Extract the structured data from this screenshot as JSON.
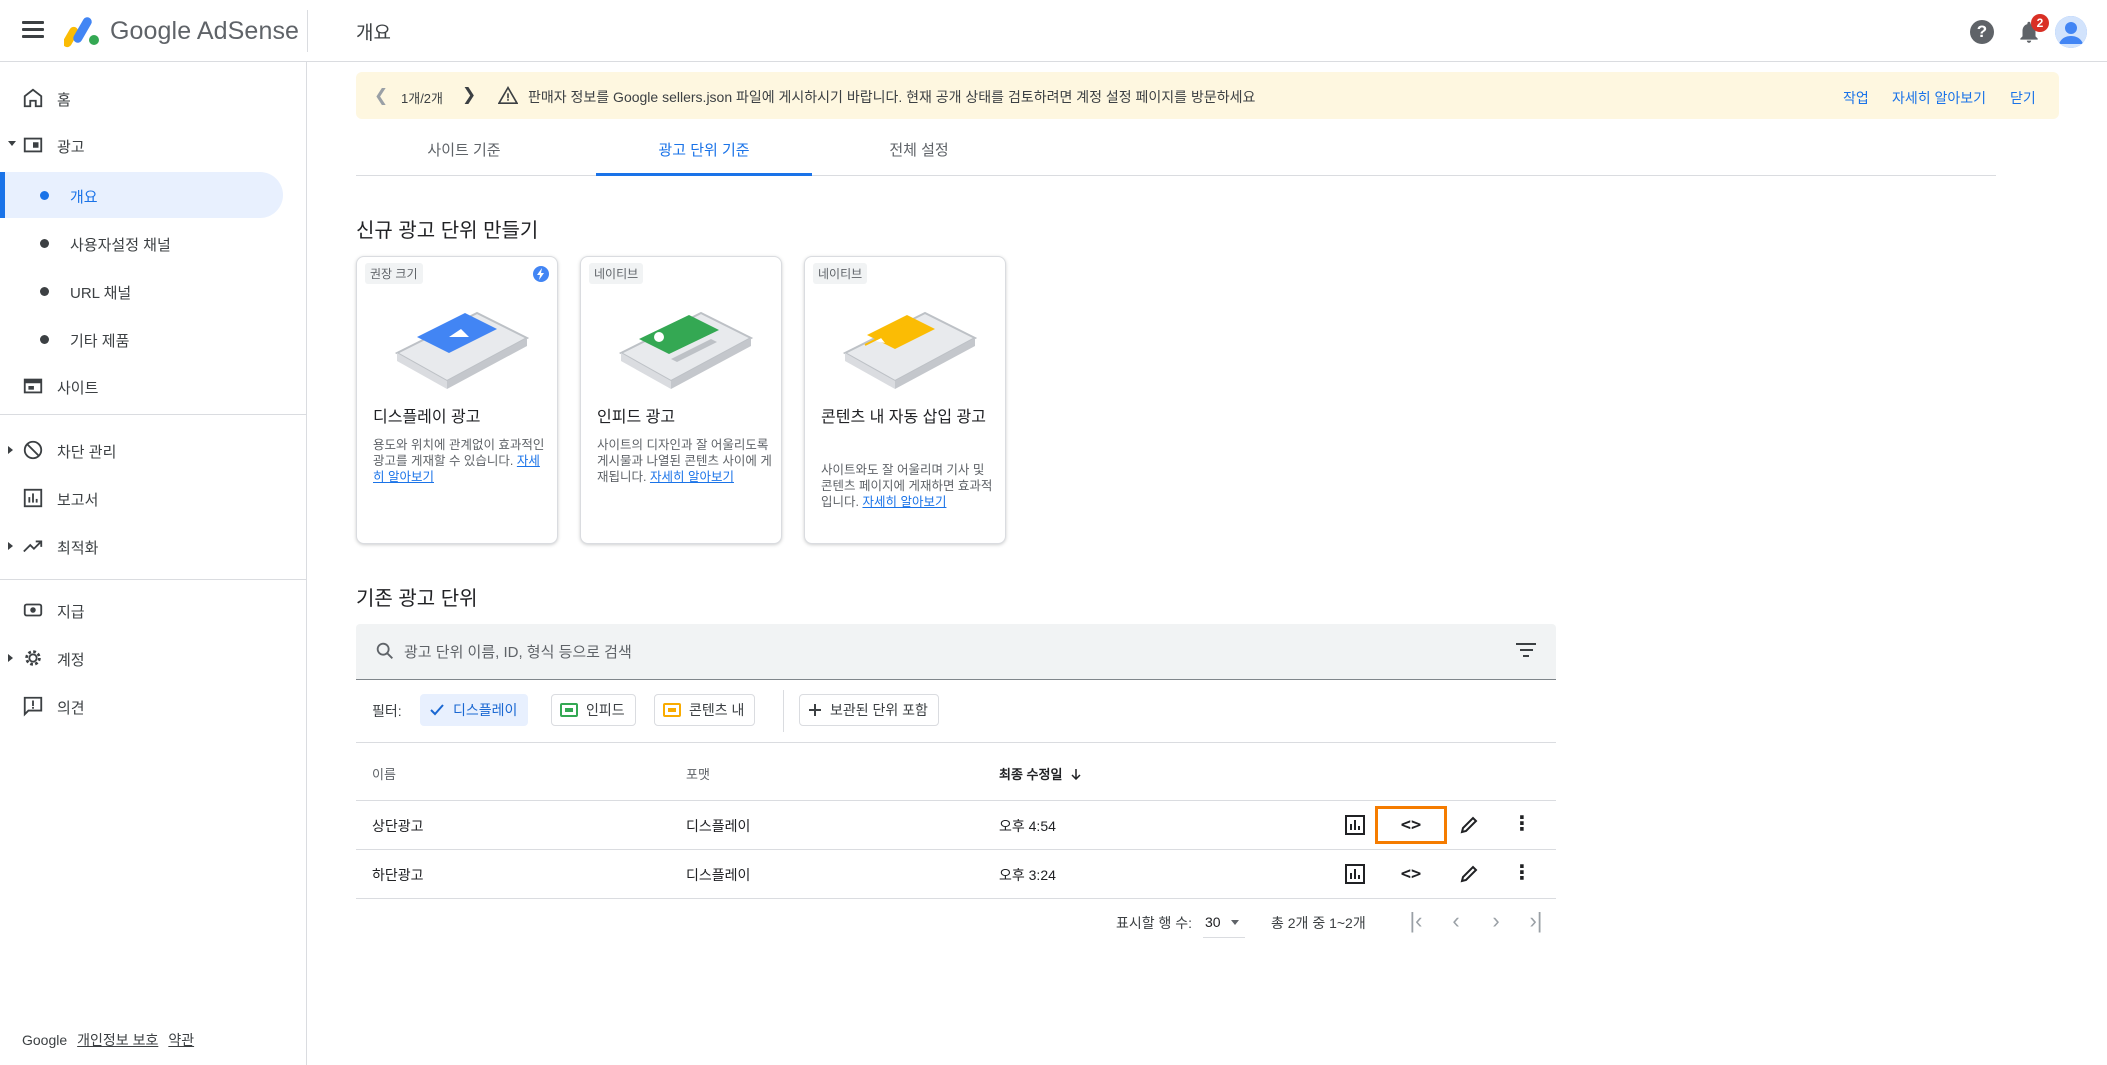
{
  "app": {
    "logo_text": "Google AdSense",
    "page_title": "개요",
    "help_label": "?",
    "notification_count": "2"
  },
  "sidebar": {
    "home": "홈",
    "ads": "광고",
    "ads_sub": [
      "개요",
      "사용자설정 채널",
      "URL 채널",
      "기타 제품"
    ],
    "sites": "사이트",
    "blocking": "차단 관리",
    "reports": "보고서",
    "optimization": "최적화",
    "payments": "지급",
    "account": "계정",
    "feedback": "의견",
    "footer": {
      "brand": "Google",
      "privacy": "개인정보 보호",
      "terms": "약관"
    }
  },
  "banner": {
    "pager": "1개/2개",
    "message": "판매자 정보를 Google sellers.json 파일에 게시하시기 바랍니다. 현재 공개 상태를 검토하려면 계정 설정 페이지를 방문하세요",
    "action": "작업",
    "learn_more": "자세히 알아보기",
    "close": "닫기"
  },
  "tabs": [
    "사이트 기준",
    "광고 단위 기준",
    "전체 설정"
  ],
  "create_section": {
    "title": "신규 광고 단위 만들기",
    "cards": [
      {
        "tag": "권장 크기",
        "title": "디스플레이 광고",
        "desc": "용도와 위치에 관계없이 효과적인 광고를 게재할 수 있습니다.",
        "link": "자세히 알아보기",
        "accent": "#4285f4"
      },
      {
        "tag": "네이티브",
        "title": "인피드 광고",
        "desc": "사이트의 디자인과 잘 어울리도록 게시물과 나열된 콘텐츠 사이에 게재됩니다.",
        "link": "자세히 알아보기",
        "accent": "#34a853"
      },
      {
        "tag": "네이티브",
        "title": "콘텐츠 내 자동 삽입 광고",
        "desc": "사이트와도 잘 어울리며 기사 및 콘텐츠 페이지에 게재하면 효과적입니다.",
        "link": "자세히 알아보기",
        "accent": "#fbbc04"
      }
    ]
  },
  "existing_section": {
    "title": "기존 광고 단위",
    "search_placeholder": "광고 단위 이름, ID, 형식 등으로 검색",
    "filter_label": "필터:",
    "chips": [
      "디스플레이",
      "인피드",
      "콘텐츠 내",
      "보관된 단위 포함"
    ],
    "columns": [
      "이름",
      "포맷",
      "최종 수정일"
    ],
    "rows": [
      {
        "name": "상단광고",
        "format": "디스플레이",
        "modified": "오후 4:54"
      },
      {
        "name": "하단광고",
        "format": "디스플레이",
        "modified": "오후 3:24"
      }
    ]
  },
  "pagination": {
    "rows_label": "표시할 행 수:",
    "rows_value": "30",
    "range": "총 2개 중 1~2개"
  },
  "colors": {
    "primary": "#1a73e8",
    "banner_bg": "#fef7e0",
    "highlight": "#f57c00"
  }
}
